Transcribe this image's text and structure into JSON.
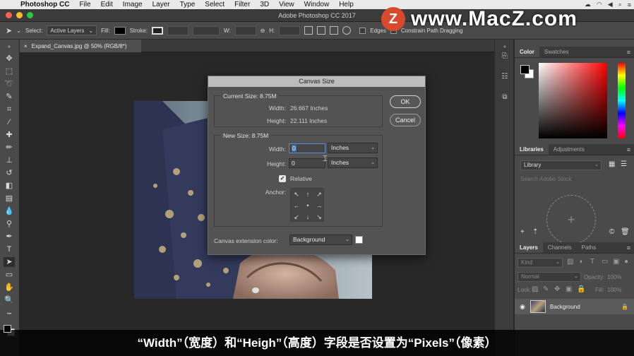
{
  "menubar": {
    "app_name": "Photoshop CC",
    "items": [
      "File",
      "Edit",
      "Image",
      "Layer",
      "Type",
      "Select",
      "Filter",
      "3D",
      "View",
      "Window",
      "Help"
    ]
  },
  "window": {
    "title": "Adobe Photoshop CC 2017"
  },
  "watermark": {
    "badge": "Z",
    "text": "www.MacZ.com"
  },
  "options_bar": {
    "select_label": "Select:",
    "select_value": "Active Layers",
    "fill_label": "Fill:",
    "stroke_label": "Stroke:",
    "w_label": "W:",
    "h_label": "H:",
    "align_edges": "Edges",
    "constrain": "Constrain Path Dragging"
  },
  "document_tab": {
    "label": "Expand_Canvas.jpg @ 50% (RGB/8*)",
    "close": "×"
  },
  "dialog": {
    "title": "Canvas Size",
    "current_size": {
      "heading": "Current Size: 8.75M",
      "width_label": "Width:",
      "width_value": "26.667 Inches",
      "height_label": "Height:",
      "height_value": "22.111 Inches"
    },
    "new_size": {
      "heading": "New Size: 8.75M",
      "width_label": "Width:",
      "width_value": "0",
      "width_unit": "Inches",
      "height_label": "Height:",
      "height_value": "0",
      "height_unit": "Inches",
      "relative_label": "Relative",
      "relative_checked": true,
      "anchor_label": "Anchor:"
    },
    "extension_label": "Canvas extension color:",
    "extension_value": "Background",
    "ok_label": "OK",
    "cancel_label": "Cancel"
  },
  "panels": {
    "color_tabs": [
      "Color",
      "Swatches"
    ],
    "libraries_tabs": [
      "Libraries",
      "Adjustments"
    ],
    "library_select": "Library",
    "library_search": "Search Adobe Stock",
    "layers_tabs": [
      "Layers",
      "Channels",
      "Paths"
    ],
    "kind_label": "Kind",
    "blend_mode": "Normal",
    "opacity_label": "Opacity:",
    "opacity_value": "100%",
    "lock_label": "Lock:",
    "fill_label": "Fill:",
    "fill_value": "100%",
    "layer_name": "Background"
  },
  "subtitle": "“Width”（宽度）和“Heigh”（高度）字段是否设置为“Pixels”（像素）"
}
